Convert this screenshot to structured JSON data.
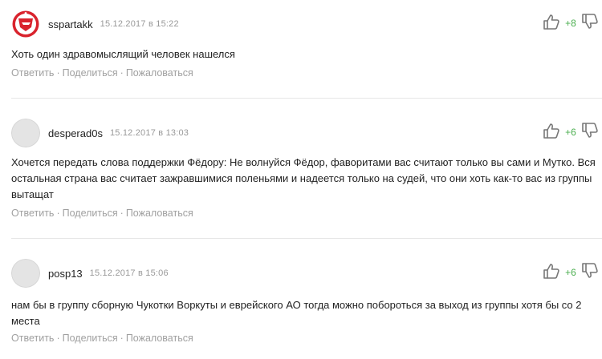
{
  "comments": [
    {
      "username": "sspartakk",
      "date": "15.12.2017 в 15:22",
      "score": "+8",
      "avatar_icon": "spartak-logo-icon",
      "text": "Хоть один здравомыслящий человек нашелся",
      "actions": {
        "reply": "Ответить",
        "share": "Поделиться",
        "report": "Пожаловаться"
      }
    },
    {
      "username": "desperad0s",
      "date": "15.12.2017 в 13:03",
      "score": "+6",
      "avatar_icon": "default-avatar-icon",
      "text": "Хочется передать слова поддержки Фёдору: Не волнуйся Фёдор, фаворитами вас считают только вы сами и Мутко. Вся остальная страна вас считает зажравшимися поленьями и надеется только на судей, что они хоть как-то вас из группы вытащат",
      "actions": {
        "reply": "Ответить",
        "share": "Поделиться",
        "report": "Пожаловаться"
      }
    },
    {
      "username": "posp13",
      "date": "15.12.2017 в 15:06",
      "score": "+6",
      "avatar_icon": "default-avatar-icon",
      "text": "нам бы в группу сборную Чукотки Воркуты и еврейского АО тогда можно побороться за выход из группы хотя бы со 2 места",
      "actions": {
        "reply": "Ответить",
        "share": "Поделиться",
        "report": "Пожаловаться"
      }
    }
  ],
  "icons": {
    "upvote": "thumbs-up-icon",
    "downvote": "thumbs-down-icon"
  },
  "colors": {
    "score": "#4caf50",
    "muted": "#a0a0a0",
    "spartak_red": "#d9232d"
  }
}
